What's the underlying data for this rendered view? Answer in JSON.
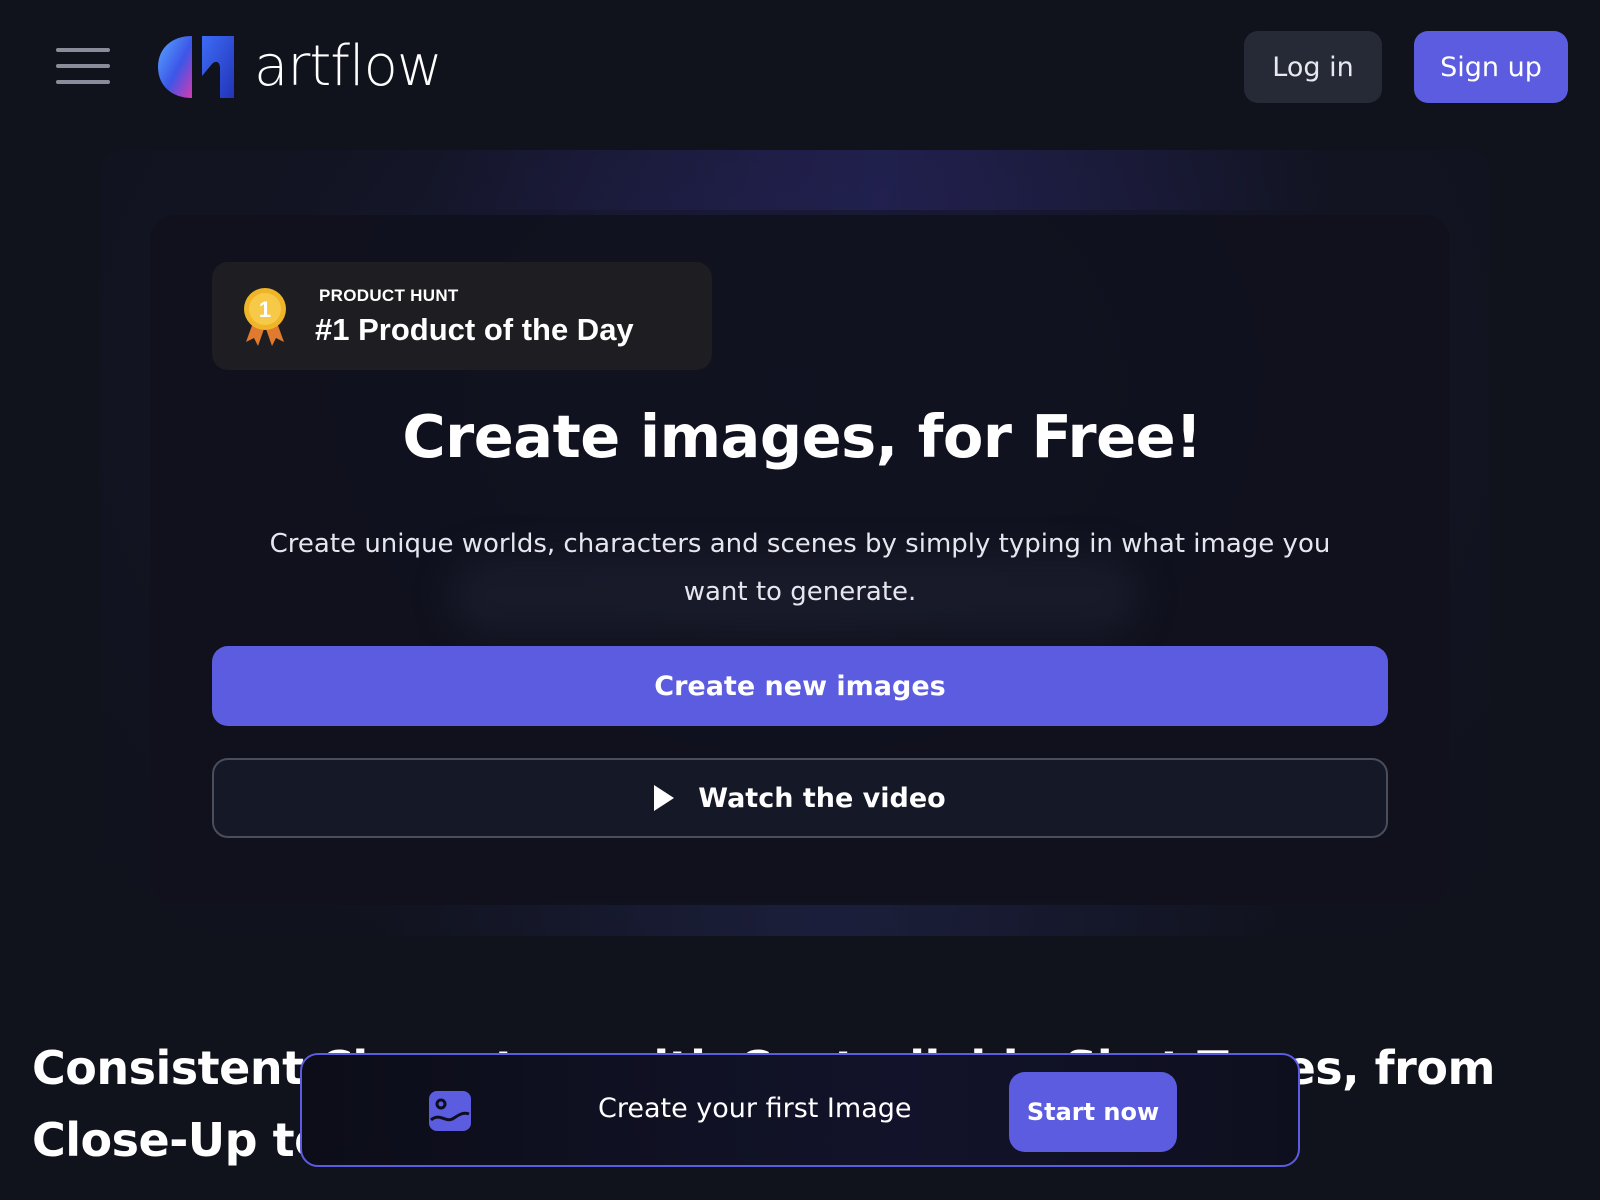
{
  "header": {
    "logo_text": "artflow",
    "login_label": "Log in",
    "signup_label": "Sign up"
  },
  "badge": {
    "kicker": "PRODUCT HUNT",
    "title": "#1 Product of the Day",
    "medal_number": "1"
  },
  "hero": {
    "title": "Create images, for Free!",
    "subtitle": "Create unique worlds, characters and scenes by simply typing in what image you want to generate.",
    "create_label": "Create new images",
    "video_label": "Watch the video"
  },
  "section": {
    "title": "Consistent Characters with Controllable Shot Types, from Close-Up to Full-Shot"
  },
  "cta": {
    "text": "Create your first Image",
    "button_label": "Start now"
  },
  "colors": {
    "background": "#10121c",
    "accent": "#5b5ce0",
    "secondary_button": "#262a37"
  },
  "icons": {
    "menu": "hamburger-icon",
    "play": "play-icon",
    "image": "image-icon",
    "medal": "medal-icon"
  }
}
